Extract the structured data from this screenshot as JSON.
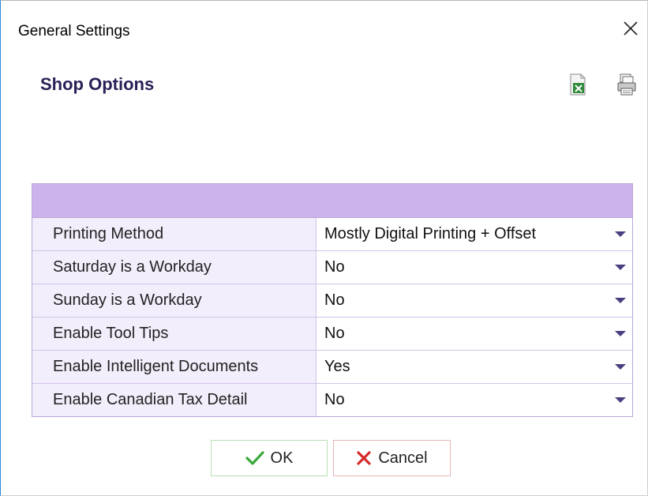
{
  "window": {
    "title": "General Settings"
  },
  "panel": {
    "heading": "Shop Options"
  },
  "toolbar": {
    "export_icon": "excel-export-icon",
    "print_icon": "print-icon"
  },
  "settings": [
    {
      "label": "Printing Method",
      "value": "Mostly Digital Printing + Offset"
    },
    {
      "label": "Saturday is a Workday",
      "value": "No"
    },
    {
      "label": "Sunday is a Workday",
      "value": "No"
    },
    {
      "label": "Enable Tool Tips",
      "value": "No"
    },
    {
      "label": "Enable Intelligent Documents",
      "value": "Yes"
    },
    {
      "label": "Enable Canadian Tax Detail",
      "value": "No"
    }
  ],
  "buttons": {
    "ok_label": "OK",
    "cancel_label": "Cancel"
  },
  "colors": {
    "header_band": "#cdb3ec",
    "label_cell": "#f3eefb",
    "heading_text": "#2a1f55",
    "ok_check": "#3aa83a",
    "cancel_x": "#d42a2a"
  }
}
